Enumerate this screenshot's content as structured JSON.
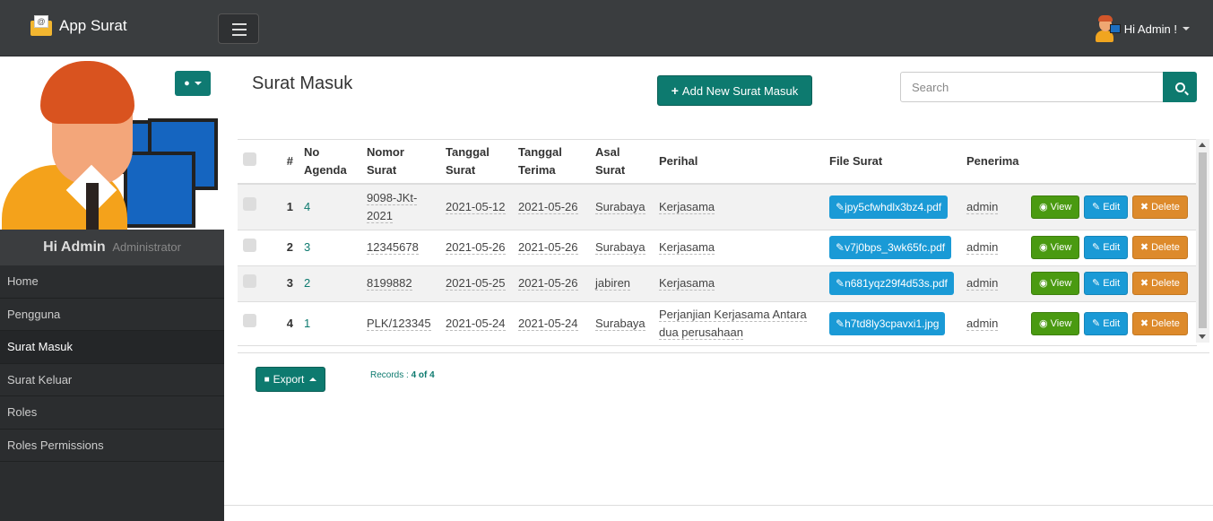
{
  "app": {
    "title": "App Surat"
  },
  "user_menu": {
    "label": "Hi Admin !"
  },
  "profile": {
    "name": "Hi Admin",
    "role": "Administrator"
  },
  "sidebar": {
    "items": [
      {
        "label": "Home",
        "active": false
      },
      {
        "label": "Pengguna",
        "active": false
      },
      {
        "label": "Surat Masuk",
        "active": true
      },
      {
        "label": "Surat Keluar",
        "active": false
      },
      {
        "label": "Roles",
        "active": false
      },
      {
        "label": "Roles Permissions",
        "active": false
      }
    ]
  },
  "page": {
    "title": "Surat Masuk",
    "add_button": "Add New Surat Masuk",
    "search_placeholder": "Search"
  },
  "table": {
    "headers": {
      "index": "#",
      "no_agenda": "No Agenda",
      "nomor_surat": "Nomor Surat",
      "tanggal_surat": "Tanggal Surat",
      "tanggal_terima": "Tanggal Terima",
      "asal_surat": "Asal Surat",
      "perihal": "Perihal",
      "file_surat": "File Surat",
      "penerima": "Penerima"
    },
    "rows": [
      {
        "index": "1",
        "no_agenda": "4",
        "nomor_surat": "9098-JKt-2021",
        "tanggal_surat": "2021-05-12",
        "tanggal_terima": "2021-05-26",
        "asal_surat": "Surabaya",
        "perihal": "Kerjasama",
        "file": "jpy5cfwhdlx3bz4.pdf",
        "penerima": "admin"
      },
      {
        "index": "2",
        "no_agenda": "3",
        "nomor_surat": "12345678",
        "tanggal_surat": "2021-05-26",
        "tanggal_terima": "2021-05-26",
        "asal_surat": "Surabaya",
        "perihal": "Kerjasama",
        "file": "v7j0bps_3wk65fc.pdf",
        "penerima": "admin"
      },
      {
        "index": "3",
        "no_agenda": "2",
        "nomor_surat": "8199882",
        "tanggal_surat": "2021-05-25",
        "tanggal_terima": "2021-05-26",
        "asal_surat": "jabiren",
        "perihal": "Kerjasama",
        "file": "n681yqz29f4d53s.pdf",
        "penerima": "admin"
      },
      {
        "index": "4",
        "no_agenda": "1",
        "nomor_surat": "PLK/123345",
        "tanggal_surat": "2021-05-24",
        "tanggal_terima": "2021-05-24",
        "asal_surat": "Surabaya",
        "perihal": "Perjanjian Kerjasama Antara dua perusahaan",
        "file": "h7td8ly3cpavxi1.jpg",
        "penerima": "admin"
      }
    ],
    "actions": {
      "view": "View",
      "edit": "Edit",
      "delete": "Delete"
    }
  },
  "footer": {
    "export_label": "Export",
    "records_prefix": "Records :",
    "records_count": "4 of 4"
  },
  "colors": {
    "navbar": "#3a3d3f",
    "sidebar": "#2b2d2f",
    "primary": "#0d7a6f",
    "view": "#4a9a11",
    "edit": "#1a9ad6",
    "delete": "#dd8a2b"
  }
}
